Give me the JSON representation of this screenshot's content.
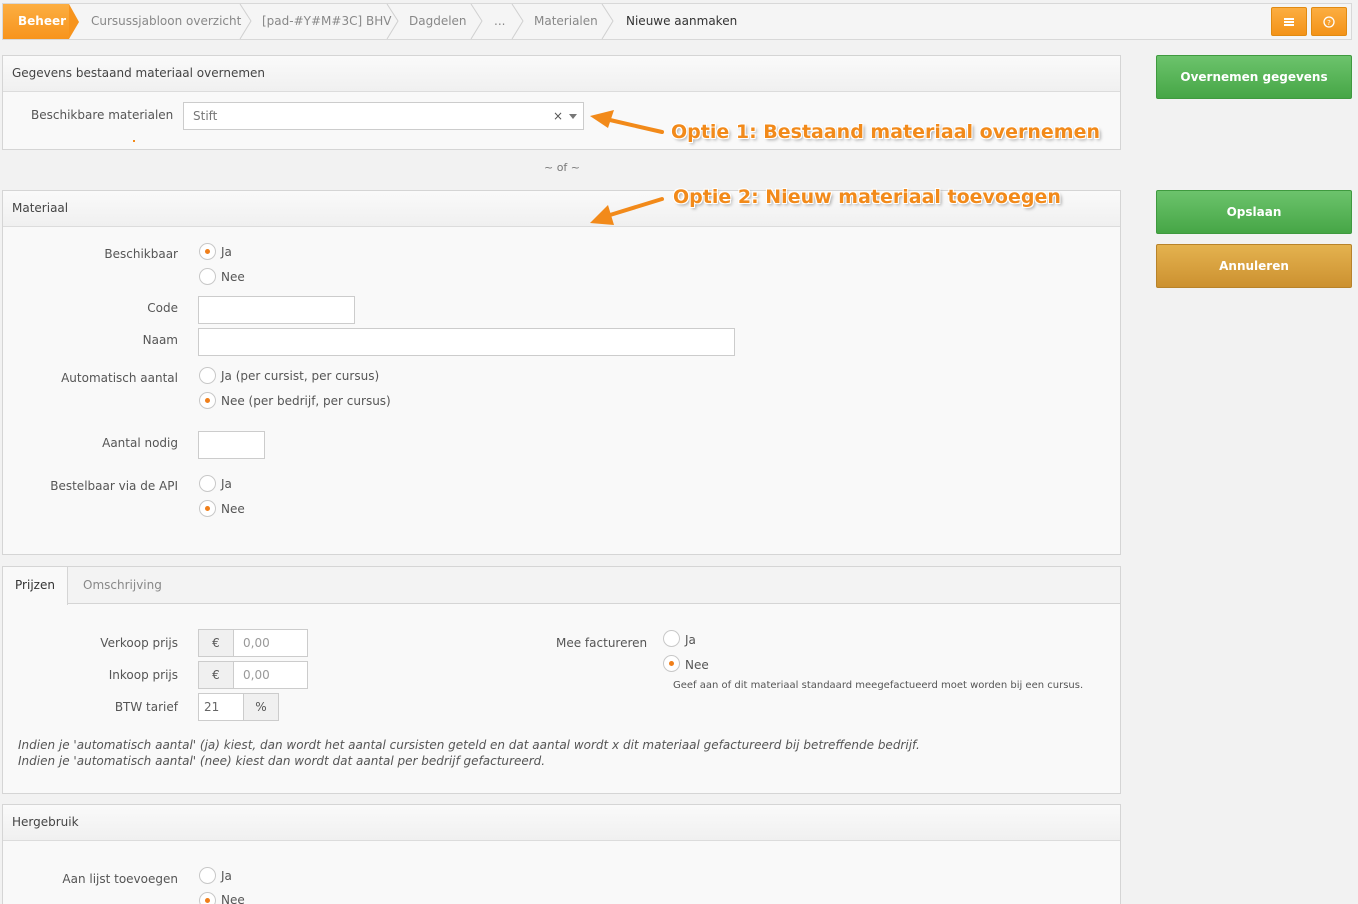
{
  "breadcrumb": {
    "items": [
      "Beheer",
      "Cursussjabloon overzicht",
      "[pad-#Y#M#3C] BHV",
      "Dagdelen",
      "...",
      "Materialen",
      "Nieuwe aanmaken"
    ],
    "buttons": [
      "list-icon",
      "help-icon"
    ]
  },
  "copy_panel": {
    "title": "Gegevens bestaand materiaal overnemen",
    "field_label": "Beschikbare materialen",
    "select_value": "Stift",
    "clear_symbol": "×"
  },
  "divider": "~ of ~",
  "annotations": {
    "option1": "Optie 1: Bestaand materiaal overnemen",
    "option2": "Optie 2: Nieuw materiaal toevoegen"
  },
  "material_panel": {
    "title": "Materiaal",
    "available": {
      "label": "Beschikbaar",
      "options": [
        "Ja",
        "Nee"
      ],
      "selected": "Ja"
    },
    "code": {
      "label": "Code",
      "value": ""
    },
    "name": {
      "label": "Naam",
      "value": ""
    },
    "auto_count": {
      "label": "Automatisch aantal",
      "options": [
        "Ja (per cursist, per cursus)",
        "Nee (per bedrijf, per cursus)"
      ],
      "selected": "Nee (per bedrijf, per cursus)"
    },
    "needed": {
      "label": "Aantal nodig",
      "value": ""
    },
    "api": {
      "label": "Bestelbaar via de API",
      "options": [
        "Ja",
        "Nee"
      ],
      "selected": "Nee"
    }
  },
  "prices_panel": {
    "tabs": [
      "Prijzen",
      "Omschrijving"
    ],
    "active_tab": "Prijzen",
    "sale_price": {
      "label": "Verkoop prijs",
      "prefix": "€",
      "placeholder": "0,00"
    },
    "purchase_price": {
      "label": "Inkoop prijs",
      "prefix": "€",
      "placeholder": "0,00"
    },
    "vat": {
      "label": "BTW tarief",
      "value": "21",
      "suffix": "%"
    },
    "invoice": {
      "label": "Mee factureren",
      "options": [
        "Ja",
        "Nee"
      ],
      "selected": "Nee",
      "hint": "Geef aan of dit materiaal standaard meegefactueerd moet worden bij een cursus."
    },
    "note_line1": "Indien je 'automatisch aantal' (ja) kiest, dan wordt het aantal cursisten geteld en dat aantal wordt x dit materiaal gefactureerd bij betreffende bedrijf.",
    "note_line2": "Indien je 'automatisch aantal' (nee) kiest dan wordt dat aantal per bedrijf gefactureerd."
  },
  "reuse_panel": {
    "title": "Hergebruik",
    "add_to_list": {
      "label": "Aan lijst toevoegen",
      "options": [
        "Ja",
        "Nee"
      ],
      "selected": "Nee"
    }
  },
  "actions": {
    "take_over": "Overnemen gegevens",
    "save": "Opslaan",
    "cancel": "Annuleren"
  },
  "colors": {
    "accent_orange": "#f7941d",
    "button_green": "#52b152",
    "button_gold": "#d9a13f",
    "annotation": "#f28a1a"
  }
}
